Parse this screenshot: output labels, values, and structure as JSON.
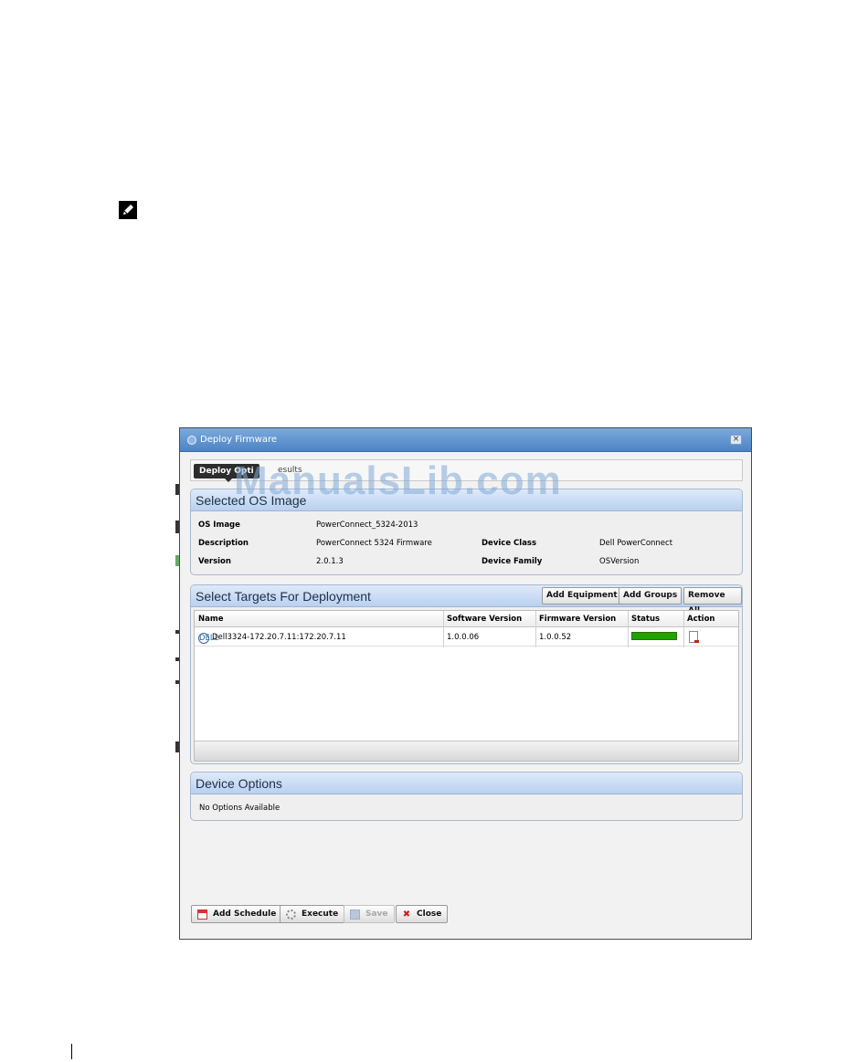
{
  "window": {
    "title": "Deploy Firmware",
    "close_glyph": "×"
  },
  "tabs": [
    {
      "label": "Deploy Opti"
    },
    {
      "label": "esults"
    }
  ],
  "watermark": "ManualsLib.com",
  "os_image_panel": {
    "title": "Selected OS Image",
    "fields": {
      "os_image": {
        "label": "OS Image",
        "value": "PowerConnect_5324-2013"
      },
      "description": {
        "label": "Description",
        "value": "PowerConnect 5324 Firmware"
      },
      "version": {
        "label": "Version",
        "value": "2.0.1.3"
      },
      "device_class": {
        "label": "Device Class",
        "value": "Dell PowerConnect"
      },
      "device_family": {
        "label": "Device Family",
        "value": "OSVersion"
      }
    }
  },
  "targets_panel": {
    "title": "Select Targets For Deployment",
    "buttons": {
      "add_equipment": "Add Equipment",
      "add_groups": "Add Groups",
      "remove_all": "Remove All"
    },
    "columns": [
      "Name",
      "Software Version",
      "Firmware Version",
      "Status",
      "Action"
    ],
    "rows": [
      {
        "icon_text": "DELL",
        "name": "Dell3324-172.20.7.11:172.20.7.11",
        "software_version": "1.0.0.06",
        "firmware_version": "1.0.0.52",
        "status_progress": 1.0
      }
    ]
  },
  "device_options_panel": {
    "title": "Device Options",
    "message": "No Options Available"
  },
  "footer_buttons": {
    "add_schedule": "Add Schedule",
    "execute": "Execute",
    "save": "Save",
    "close": "Close"
  },
  "colors": {
    "titlebar": "#4e84c4",
    "status_ok": "#21a300",
    "panel_header": "#b9d0ef"
  }
}
